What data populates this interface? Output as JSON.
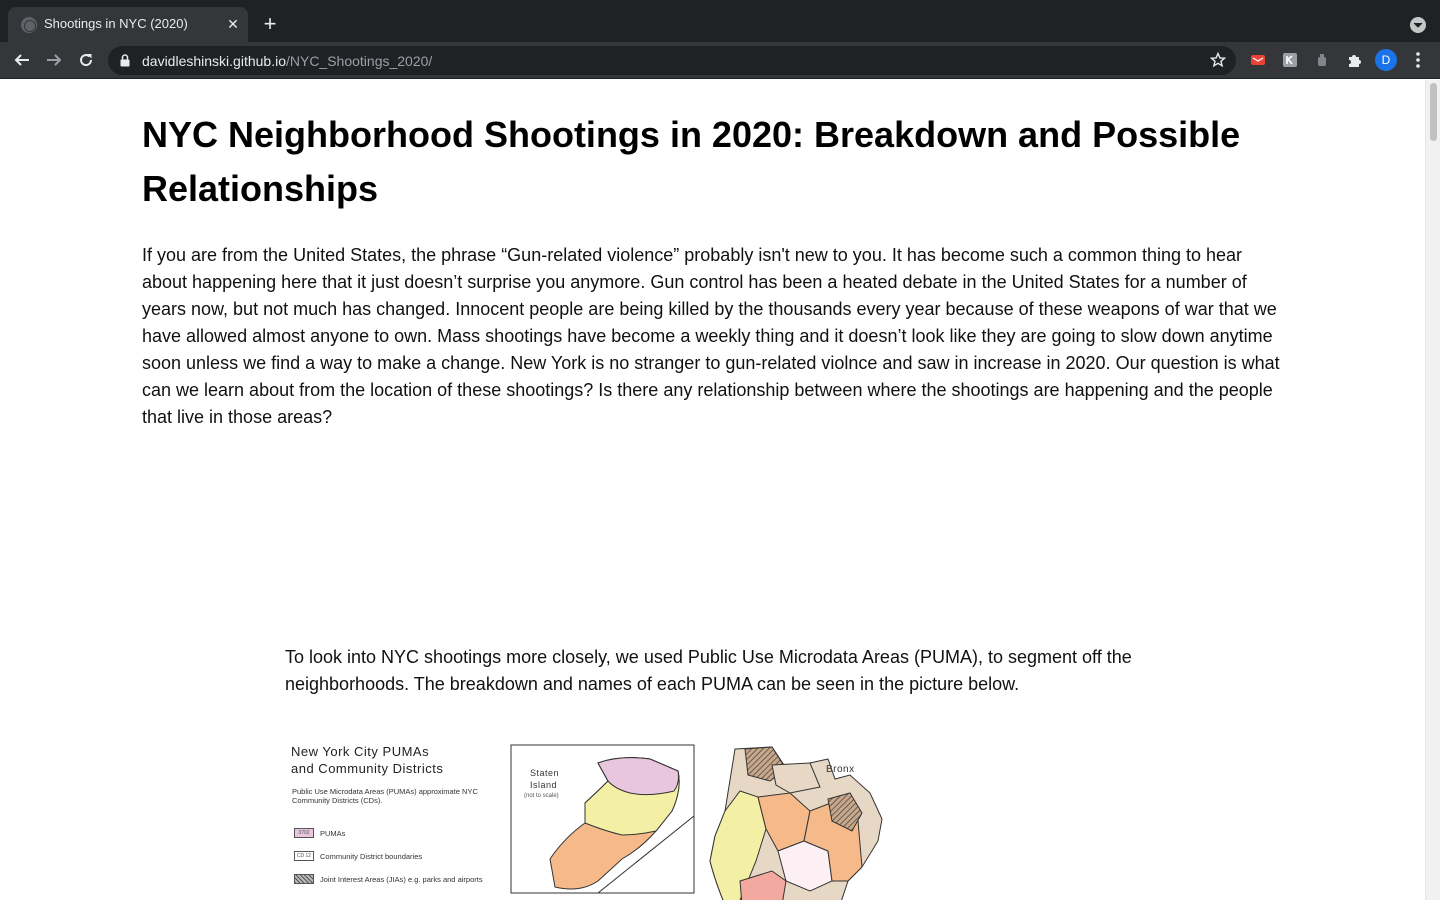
{
  "browser": {
    "tab_title": "Shootings in NYC (2020)",
    "url_host": "davidleshinski.github.io",
    "url_path": "/NYC_Shootings_2020/",
    "profile_initial": "D"
  },
  "article": {
    "title": "NYC Neighborhood Shootings in 2020: Breakdown and Possible Relationships",
    "intro": "If you are from the United States, the phrase “Gun-related violence” probably isn't new to you. It has become such a common thing to hear about happening here that it just doesn’t surprise you anymore. Gun control has been a heated debate in the United States for a number of years now, but not much has changed. Innocent people are being killed by the thousands every year because of these weapons of war that we have allowed almost anyone to own. Mass shootings have become a weekly thing and it doesn’t look like they are going to slow down anytime soon unless we find a way to make a change. New York is no stranger to gun-related violnce and saw in increase in 2020. Our question is what can we learn about from the location of these shootings? Is there any relationship between where the shootings are happening and the people that live in those areas?",
    "puma_paragraph": "To look into NYC shootings more closely, we used Public Use Microdata Areas (PUMA), to segment off the neighborhoods. The breakdown and names of each PUMA can be seen in the picture below."
  },
  "map": {
    "title": "New York City PUMAs\nand Community Districts",
    "subtitle": "Public Use Microdata Areas (PUMAs) approximate NYC Community Districts (CDs).",
    "legend": {
      "puma": "PUMAs",
      "puma_swatch": "3702",
      "cd": "Community District boundaries",
      "cd_swatch": "CD 12",
      "jia": "Joint Interest Areas (JIAs) e.g. parks and airports"
    },
    "staten_island_label": "Staten\nIsland",
    "staten_island_note": "(not to scale)",
    "bronx_label": "Bronx",
    "colors": {
      "yellow": "#f3f0a6",
      "orange": "#f5b98a",
      "pink": "#e7c6de",
      "salmon": "#f4a9a0",
      "tan": "#e6d8c4"
    }
  }
}
